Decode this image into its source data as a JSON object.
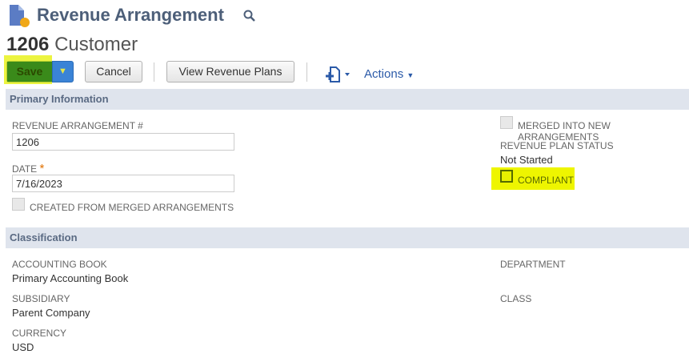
{
  "header": {
    "title": "Revenue Arrangement",
    "record_number": "1206",
    "record_name": "Customer"
  },
  "toolbar": {
    "save": "Save",
    "cancel": "Cancel",
    "view_plans": "View Revenue Plans",
    "actions": "Actions"
  },
  "sections": {
    "primary": "Primary Information",
    "classification": "Classification"
  },
  "fields": {
    "ra_label": "REVENUE ARRANGEMENT #",
    "ra_value": "1206",
    "date_label": "DATE",
    "date_value": "7/16/2023",
    "required": "*",
    "created_merged": "CREATED FROM MERGED ARRANGEMENTS",
    "merged_new": "MERGED INTO NEW ARRANGEMENTS",
    "plan_status_label": "REVENUE PLAN STATUS",
    "plan_status_value": "Not Started",
    "compliant": "COMPLIANT",
    "book_label": "ACCOUNTING BOOK",
    "book_value": "Primary Accounting Book",
    "sub_label": "SUBSIDIARY",
    "sub_value": "Parent Company",
    "cur_label": "CURRENCY",
    "cur_value": "USD",
    "dept_label": "DEPARTMENT",
    "class_label": "CLASS"
  },
  "colors": {
    "highlight": "#e6f000",
    "save_blue": "#3a83d6",
    "band": "#dfe4ed"
  }
}
